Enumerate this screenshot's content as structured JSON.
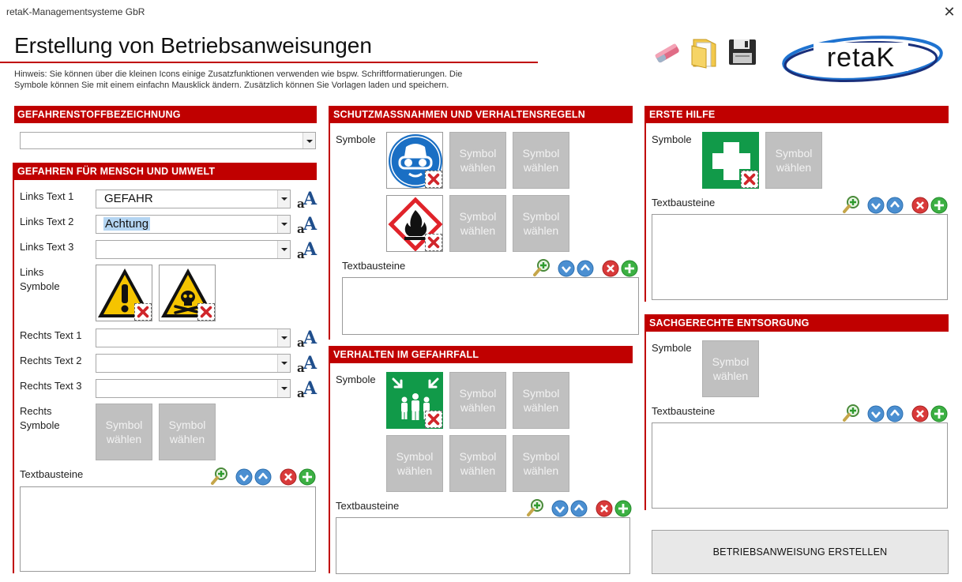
{
  "window": {
    "title": "retaK-Managementsysteme GbR",
    "close_icon": "close-icon"
  },
  "page": {
    "title": "Erstellung von Betriebsanweisungen",
    "hint_line1": "Hinweis: Sie können über die kleinen Icons einige Zusatzfunktionen verwenden wie bspw. Schriftformatierungen. Die",
    "hint_line2": "Symbole können Sie mit einem einfachn Mausklick ändern. Zusätzlich können Sie Vorlagen laden und speichern."
  },
  "toolbar": {
    "icons": [
      "eraser-icon",
      "folder-icon",
      "save-disk-icon"
    ],
    "logo_text": "retaK"
  },
  "common": {
    "symbol_placeholder_line1": "Symbol",
    "symbol_placeholder_line2": "wählen",
    "textbausteine_label": "Textbausteine",
    "symbole_label": "Symbole"
  },
  "gefahrstoff": {
    "header": "GEFAHRENSTOFFBEZEICHNUNG",
    "value": ""
  },
  "gefahren": {
    "header": "GEFAHREN FÜR MENSCH UND UMWELT",
    "links_text_1_label": "Links Text 1",
    "links_text_1_value": "GEFAHR",
    "links_text_2_label": "Links Text 2",
    "links_text_2_value": "Achtung",
    "links_text_3_label": "Links Text 3",
    "links_text_3_value": "",
    "links_symbole_label_1": "Links",
    "links_symbole_label_2": "Symbole",
    "links_symbols": [
      "exclamation-warning-icon",
      "toxic-skull-warning-icon"
    ],
    "rechts_text_1_label": "Rechts Text 1",
    "rechts_text_2_label": "Rechts Text 2",
    "rechts_text_3_label": "Rechts Text 3",
    "rechts_symbole_label_1": "Rechts",
    "rechts_symbole_label_2": "Symbole"
  },
  "schutz": {
    "header": "SCHUTZMASSNAHMEN UND VERHALTENSREGELN",
    "symbols": [
      "eye-protection-icon",
      "flammable-ghs-icon"
    ]
  },
  "verhalten": {
    "header": "VERHALTEN IM GEFAHRFALL",
    "symbols": [
      "assembly-point-icon"
    ]
  },
  "erste_hilfe": {
    "header": "ERSTE HILFE",
    "symbols": [
      "first-aid-cross-icon"
    ]
  },
  "entsorgung": {
    "header": "SACHGERECHTE ENTSORGUNG"
  },
  "actions": {
    "create_label": "BETRIEBSANWEISUNG ERSTELLEN"
  },
  "colors": {
    "accent": "#c00000",
    "placeholder_tile": "#c0c0c0",
    "mandatory_blue": "#1a6fc4",
    "safety_green": "#119a49"
  }
}
